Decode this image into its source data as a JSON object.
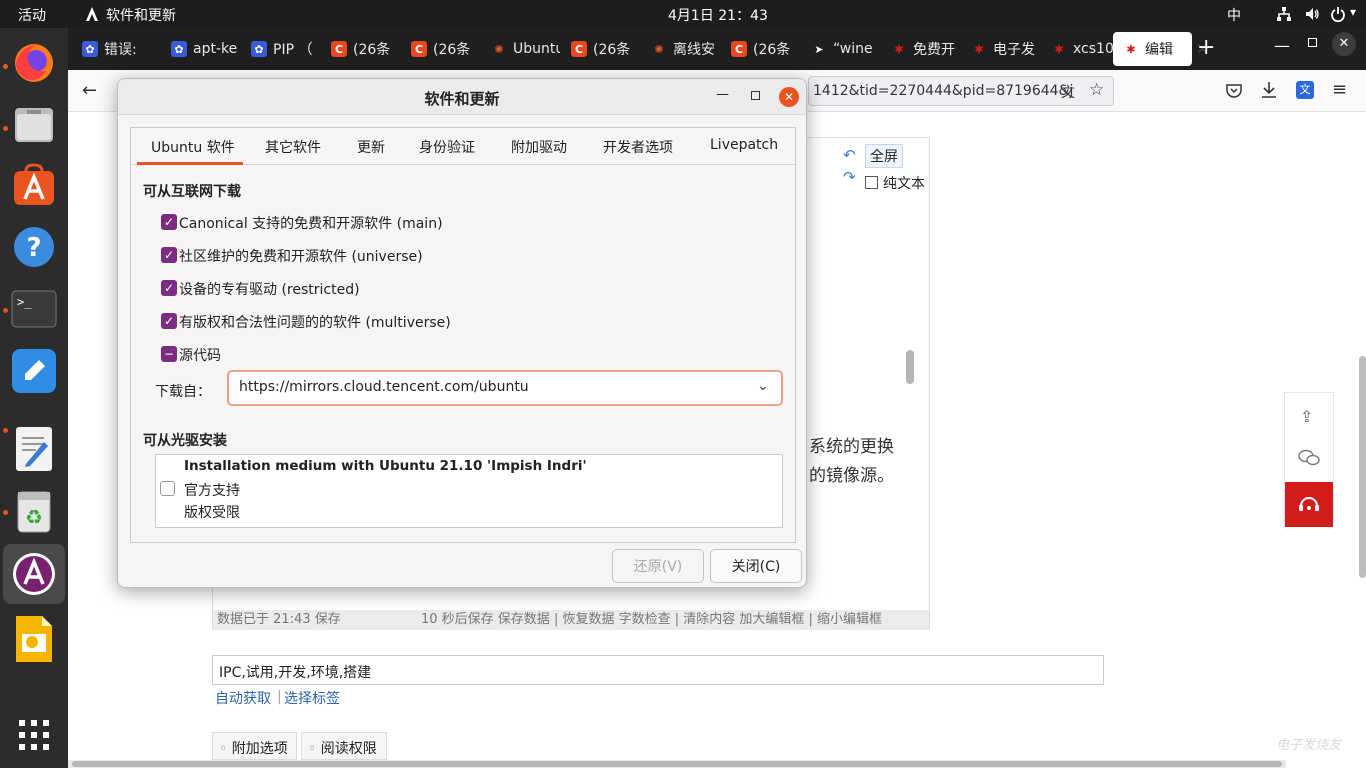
{
  "topbar": {
    "activities": "活动",
    "app_name": "软件和更新",
    "clock": "4月1日  21：43",
    "ime": "中"
  },
  "tabs": [
    {
      "label": "错误:",
      "icon": "baidu-icon",
      "color": "#3b5bd9"
    },
    {
      "label": "apt-ke",
      "icon": "baidu-icon",
      "color": "#3b5bd9"
    },
    {
      "label": "PIP （",
      "icon": "baidu-icon",
      "color": "#3b5bd9"
    },
    {
      "label": "(26条",
      "icon": "csdn-icon",
      "color": "#e8481f"
    },
    {
      "label": "(26条",
      "icon": "csdn-icon",
      "color": "#e8481f"
    },
    {
      "label": "Ubuntu -",
      "icon": "ubuntu-icon",
      "color": "#1f1f1f"
    },
    {
      "label": "(26条",
      "icon": "csdn-icon",
      "color": "#e8481f"
    },
    {
      "label": "离线安",
      "icon": "ubuntu-icon",
      "color": "#1f1f1f"
    },
    {
      "label": "(26条",
      "icon": "csdn-icon",
      "color": "#e8481f"
    },
    {
      "label": "“wine",
      "icon": "arrow-icon",
      "color": "#1f1f1f"
    },
    {
      "label": "免费开",
      "icon": "elecfans-icon",
      "color": "#1f1f1f"
    },
    {
      "label": "电子发",
      "icon": "elecfans-icon",
      "color": "#1f1f1f"
    },
    {
      "label": "xcs10",
      "icon": "elecfans-icon",
      "color": "#1f1f1f"
    },
    {
      "label": "编辑",
      "icon": "elecfans-icon",
      "color": "#ffffff"
    }
  ],
  "navbar": {
    "url_tail": "1412&tid=2270444&pid=8719644&j"
  },
  "editor": {
    "fullscreen": "全屏",
    "plaintext": "纯文本",
    "body_line1": "系统的更换",
    "body_line2": "的镜像源。",
    "status_left": "数据已于 21:43 保存",
    "status_right": "10 秒后保存 保存数据 | 恢复数据    字数检查 | 清除内容    加大编辑框 | 缩小编辑框"
  },
  "tags": {
    "value": "IPC,试用,开发,环境,搭建",
    "auto": "自动获取",
    "choose": "选择标签"
  },
  "options": {
    "extra": "附加选项",
    "read": "阅读权限"
  },
  "watermark": "电子发烧友",
  "dialog": {
    "title": "软件和更新",
    "tabs": [
      "Ubuntu 软件",
      "其它软件",
      "更新",
      "身份验证",
      "附加驱动",
      "开发者选项",
      "Livepatch"
    ],
    "section_internet": "可从互联网下载",
    "items": [
      {
        "label": "Canonical 支持的免费和开源软件 (main)",
        "state": "checked"
      },
      {
        "label": "社区维护的免费和开源软件 (universe)",
        "state": "checked"
      },
      {
        "label": "设备的专有驱动 (restricted)",
        "state": "checked"
      },
      {
        "label": "有版权和合法性问题的的软件 (multiverse)",
        "state": "checked"
      },
      {
        "label": "源代码",
        "state": "mixed"
      }
    ],
    "download_from_label": "下载自：",
    "download_from_value": "https://mirrors.cloud.tencent.com/ubuntu",
    "section_cdrom": "可从光驱安装",
    "cdrom_title": "Installation medium with Ubuntu 21.10 'Impish Indri'",
    "cdrom_line1": "官方支持",
    "cdrom_line2": "版权受限",
    "revert": "还原(V)",
    "close": "关闭(C)"
  }
}
